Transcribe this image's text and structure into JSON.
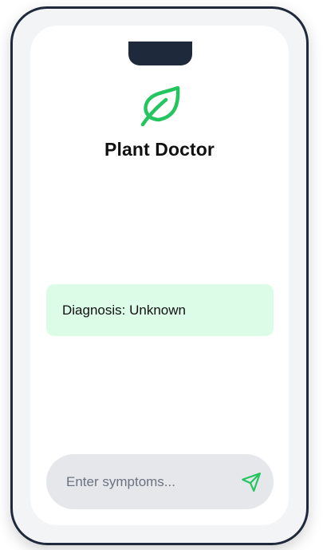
{
  "app": {
    "title": "Plant Doctor",
    "logo_icon": "leaf-icon",
    "accent_color": "#22c55e"
  },
  "diagnosis": {
    "text": "Diagnosis: Unknown",
    "background_color": "#dcfce7"
  },
  "symptom_input": {
    "value": "",
    "placeholder": "Enter symptoms..."
  },
  "send_button": {
    "icon": "send-icon",
    "color": "#22c55e"
  },
  "device": {
    "frame_color": "#1e293b",
    "bezel_color": "#f3f4f6"
  }
}
